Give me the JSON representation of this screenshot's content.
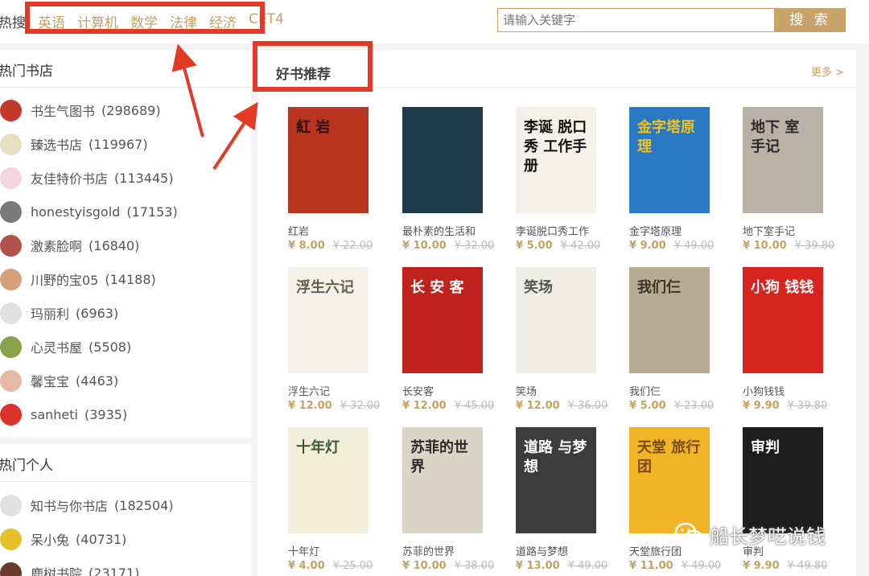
{
  "header": {
    "hot_search_label": "热搜",
    "tags": [
      "英语",
      "计算机",
      "数学",
      "法律",
      "经济",
      "CET4"
    ],
    "search_placeholder": "请输入关键字",
    "search_button": "搜 索"
  },
  "hot_stores": {
    "title": "热门书店",
    "items": [
      {
        "name": "书生气图书",
        "count": "(298689)",
        "color": "#c0392b"
      },
      {
        "name": "臻选书店",
        "count": "(119967)",
        "color": "#e8ddc2"
      },
      {
        "name": "友佳特价书店",
        "count": "(113445)",
        "color": "#f2d6e2"
      },
      {
        "name": "honestyisgold",
        "count": "(17153)",
        "color": "#7a7a7a"
      },
      {
        "name": "激素脸啊",
        "count": "(16840)",
        "color": "#b0524a"
      },
      {
        "name": "川野的宝05",
        "count": "(14188)",
        "color": "#d4a17a"
      },
      {
        "name": "玛丽利",
        "count": "(6963)",
        "color": "#e1e1e1"
      },
      {
        "name": "心灵书屋",
        "count": "(5508)",
        "color": "#8aa24c"
      },
      {
        "name": "馨宝宝",
        "count": "(4463)",
        "color": "#e6b8a6"
      },
      {
        "name": "sanheti",
        "count": "(3935)",
        "color": "#d8322a"
      }
    ]
  },
  "hot_people": {
    "title": "热门个人",
    "items": [
      {
        "name": "知书与你书店",
        "count": "(182504)",
        "color": "#e1e1e1"
      },
      {
        "name": "呆小兔",
        "count": "(40731)",
        "color": "#e6c12d"
      },
      {
        "name": "鹿树书院",
        "count": "(23171)",
        "color": "#6b3a2a"
      }
    ]
  },
  "recommend": {
    "title": "好书推荐",
    "more": "更多 >",
    "books": [
      {
        "title": "红岩",
        "price": "¥ 8.00",
        "orig": "¥ 22.00",
        "bg": "#b8341f",
        "fg": "#2a140f",
        "cover_text": "紅 岩"
      },
      {
        "title": "最朴素的生活和",
        "price": "¥ 10.00",
        "orig": "¥ 32.00",
        "bg": "#1f3b4a",
        "fg": "#d8b53a",
        "cover_text": ""
      },
      {
        "title": "李诞脱口秀工作",
        "price": "¥ 5.00",
        "orig": "¥ 42.00",
        "bg": "#f4f1e8",
        "fg": "#111111",
        "cover_text": "李诞 脱口秀 工作手册"
      },
      {
        "title": "金字塔原理",
        "price": "¥ 9.00",
        "orig": "¥ 49.00",
        "bg": "#2b78c2",
        "fg": "#f3c31a",
        "cover_text": "金字塔原理"
      },
      {
        "title": "地下室手记",
        "price": "¥ 10.00",
        "orig": "¥ 39.80",
        "bg": "#b8b1a6",
        "fg": "#2b2b2b",
        "cover_text": "地下 室 手记"
      },
      {
        "title": "浮生六记",
        "price": "¥ 12.00",
        "orig": "¥ 32.00",
        "bg": "#f3f1ea",
        "fg": "#6a5d4a",
        "cover_text": "浮生六记"
      },
      {
        "title": "长安客",
        "price": "¥ 12.00",
        "orig": "¥ 45.00",
        "bg": "#c0231d",
        "fg": "#ffffff",
        "cover_text": "长 安 客"
      },
      {
        "title": "笑场",
        "price": "¥ 12.00",
        "orig": "¥ 36.00",
        "bg": "#eeeee4",
        "fg": "#555555",
        "cover_text": "笑场"
      },
      {
        "title": "我们仨",
        "price": "¥ 5.00",
        "orig": "¥ 23.00",
        "bg": "#b7ab94",
        "fg": "#3b3326",
        "cover_text": "我们仨"
      },
      {
        "title": "小狗钱钱",
        "price": "¥ 9.90",
        "orig": "¥ 39.80",
        "bg": "#d8241e",
        "fg": "#ffffff",
        "cover_text": "小狗 钱钱"
      },
      {
        "title": "十年灯",
        "price": "¥ 4.00",
        "orig": "¥ 25.00",
        "bg": "#f1efd9",
        "fg": "#3c5a3a",
        "cover_text": "十年灯"
      },
      {
        "title": "苏菲的世界",
        "price": "¥ 10.00",
        "orig": "¥ 38.00",
        "bg": "#d9d6c8",
        "fg": "#2b2b2b",
        "cover_text": "苏菲的世界"
      },
      {
        "title": "道路与梦想",
        "price": "¥ 13.00",
        "orig": "¥ 49.00",
        "bg": "#3c3c3c",
        "fg": "#ffffff",
        "cover_text": "道路 与梦想"
      },
      {
        "title": "天堂旅行团",
        "price": "¥ 11.00",
        "orig": "¥ 49.00",
        "bg": "#f0b424",
        "fg": "#7a4a14",
        "cover_text": "天堂 旅行团"
      },
      {
        "title": "审判",
        "price": "¥ 9.90",
        "orig": "¥ 49.80",
        "bg": "#1e1e1e",
        "fg": "#ffffff",
        "cover_text": "审判"
      }
    ]
  },
  "watermark": {
    "text": "船长梦呓说钱"
  }
}
